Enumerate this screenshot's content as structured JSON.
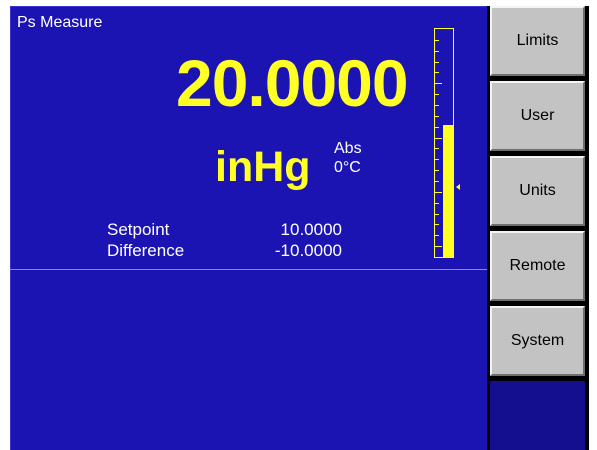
{
  "screen": {
    "title": "Ps Measure",
    "reading": {
      "value": "20.0000",
      "unit": "inHg",
      "mode": "Abs",
      "temperature": "0°C"
    },
    "setpoint": {
      "label": "Setpoint",
      "value": "10.0000"
    },
    "difference": {
      "label": "Difference",
      "value": "-10.0000"
    },
    "bar_graph": {
      "fill_fraction": 0.58,
      "marker_fraction": 0.31
    }
  },
  "side_menu": {
    "limits_label": "Limits",
    "user_label": "User",
    "units_label": "Units",
    "remote_label": "Remote",
    "system_label": "System"
  },
  "colors": {
    "background": "#1b14b2",
    "reading": "#ffff26",
    "text": "#ffffff",
    "button": "#c3c3c3"
  }
}
